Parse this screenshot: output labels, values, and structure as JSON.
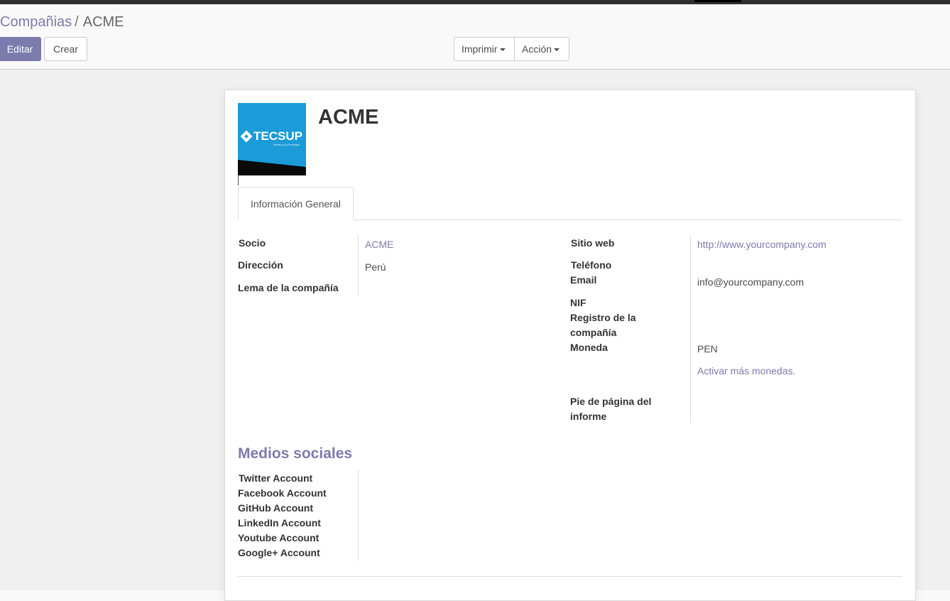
{
  "breadcrumb": {
    "parent": "Compañias",
    "separator": "/",
    "current": "ACME"
  },
  "toolbar": {
    "edit_label": "Editar",
    "create_label": "Crear",
    "print_label": "Imprimir",
    "action_label": "Acción"
  },
  "record": {
    "name": "ACME",
    "logo_text": "TECSUP",
    "logo_tagline": "Pasión por la Tecnología",
    "tab_general": "Información General"
  },
  "left_fields": {
    "partner_label": "Socio",
    "partner_value": "ACME",
    "address_label": "Dirección",
    "address_value": "Perú",
    "slogan_label": "Lema de la compañía"
  },
  "right_fields": {
    "website_label": "Sitio web",
    "website_value": "http://www.yourcompany.com",
    "phone_label": "Teléfono",
    "email_label": "Email",
    "email_value": "info@yourcompany.com",
    "vat_label": "NIF",
    "registry_label_1": "Registro de la",
    "registry_label_2": "compañía",
    "currency_label": "Moneda",
    "currency_value": "PEN",
    "activate_currencies": "Activar más monedas.",
    "footer_label_1": "Pie de página del",
    "footer_label_2": "informe"
  },
  "social": {
    "title": "Medios sociales",
    "twitter_label": "Twitter Account",
    "facebook_label": "Facebook Account",
    "github_label": "GitHub Account",
    "linkedin_label": "LinkedIn Account",
    "youtube_label": "Youtube Account",
    "googleplus_label": "Google+ Account"
  },
  "colors": {
    "brand": "#7c7bad",
    "logo_blue": "#1b9bd8",
    "text": "#4c4c4c"
  },
  "icons": {
    "dropdown": "caret-down-icon"
  }
}
